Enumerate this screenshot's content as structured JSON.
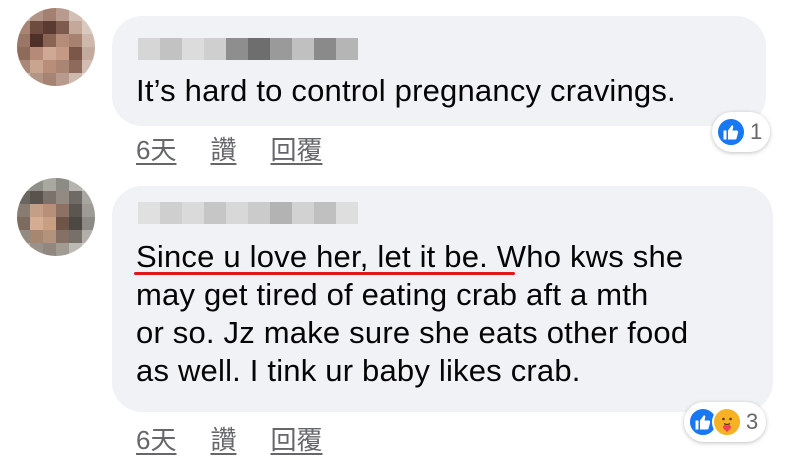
{
  "comments": [
    {
      "text": "It’s hard to control pregnancy cravings.",
      "actions": {
        "time": "6天",
        "like": "讚",
        "reply": "回覆"
      },
      "reactions": {
        "icons": [
          "like-icon"
        ],
        "count": "1"
      }
    },
    {
      "text_underlined": "Since u love her, let it be",
      "text_rest": ". Who kws she\nmay get tired of eating crab aft a mth\nor so. Jz make sure she eats other food\nas well. I tink ur baby likes crab.",
      "actions": {
        "time": "6天",
        "like": "讚",
        "reply": "回覆"
      },
      "reactions": {
        "icons": [
          "like-icon",
          "care-icon"
        ],
        "count": "3"
      }
    }
  ],
  "colors": {
    "bubble": "#f0f2f5",
    "text": "#050505",
    "secondary": "#65676b",
    "like_blue": "#1877f2",
    "underline_red": "#e0161b"
  }
}
